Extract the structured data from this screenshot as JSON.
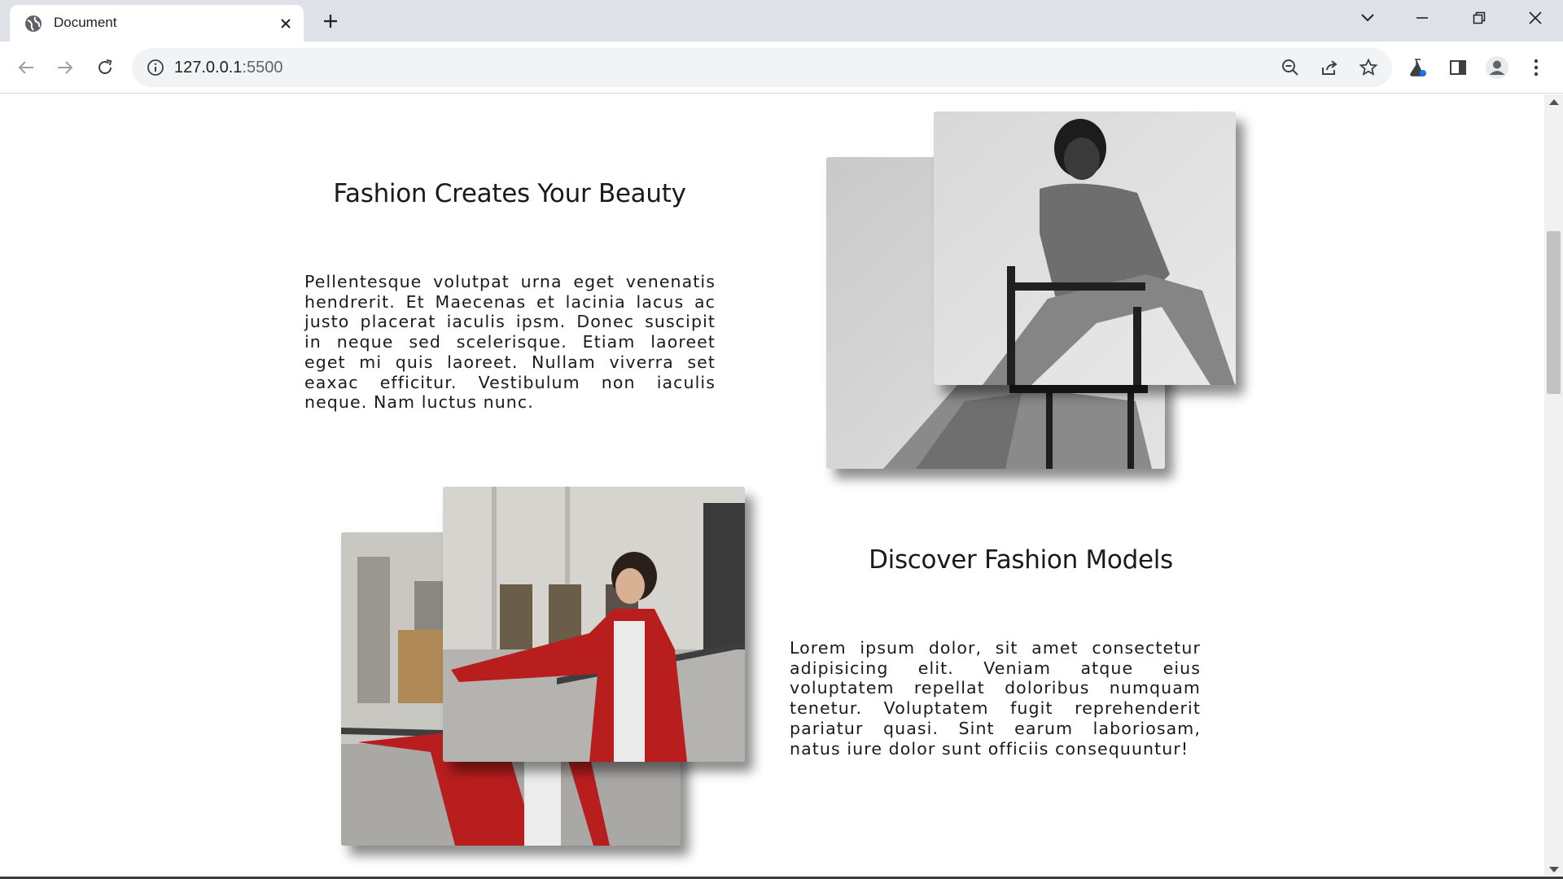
{
  "browser": {
    "tab_title": "Document",
    "url_host": "127.0.0.1",
    "url_port": ":5500"
  },
  "sections": [
    {
      "heading": "Fashion Creates Your Beauty",
      "body": "Pellentesque volutpat urna eget venenatis hendrerit. Et Maecenas et lacinia lacus ac justo placerat iaculis ipsm. Donec suscipit in neque sed scelerisque. Etiam laoreet eget mi quis laoreet. Nullam viverra set eaxac efficitur. Vestibulum non iaculis neque. Nam luctus nunc."
    },
    {
      "heading": "Discover Fashion Models",
      "body": "Lorem ipsum dolor, sit amet consectetur adipisicing elit. Veniam atque eius voluptatem repellat doloribus numquam tenetur. Voluptatem fugit reprehenderit pariatur quasi. Sint earum laboriosam, natus iure dolor sunt officiis consequuntur!"
    }
  ],
  "icons": {
    "favicon": "globe-icon",
    "back": "arrow-left-icon",
    "forward": "arrow-right-icon",
    "reload": "reload-icon",
    "site_info": "info-icon",
    "zoom": "zoom-out-icon",
    "share": "share-icon",
    "bookmark": "star-icon",
    "labs": "flask-icon",
    "side_panel": "side-panel-icon",
    "profile": "avatar-icon",
    "menu": "kebab-menu-icon"
  }
}
